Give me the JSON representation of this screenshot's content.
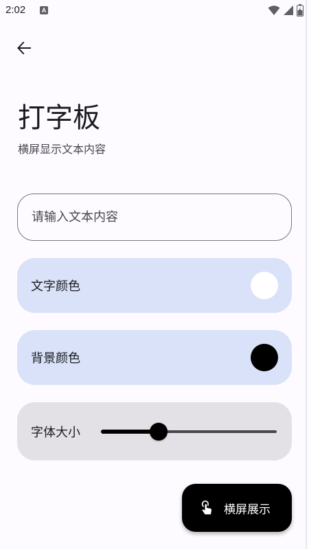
{
  "status_bar": {
    "time": "2:02",
    "notification_letter": "A",
    "icons": [
      "wifi-icon",
      "signal-icon",
      "battery-icon"
    ]
  },
  "header": {
    "back_icon": "arrow-left-icon",
    "title": "打字板",
    "subtitle": "横屏显示文本内容"
  },
  "input": {
    "value": "",
    "placeholder": "请输入文本内容"
  },
  "text_color_card": {
    "label": "文字颜色",
    "swatch_color": "#ffffff"
  },
  "background_color_card": {
    "label": "背景颜色",
    "swatch_color": "#000000"
  },
  "font_size_card": {
    "label": "字体大小",
    "slider_fraction": 0.33
  },
  "fab": {
    "icon": "touch-gesture-icon",
    "label": "横屏展示"
  },
  "colors": {
    "background": "#fdfbff",
    "card_blue": "#d9e2f8",
    "card_gray": "#e4e1e6",
    "accent": "#000000"
  }
}
